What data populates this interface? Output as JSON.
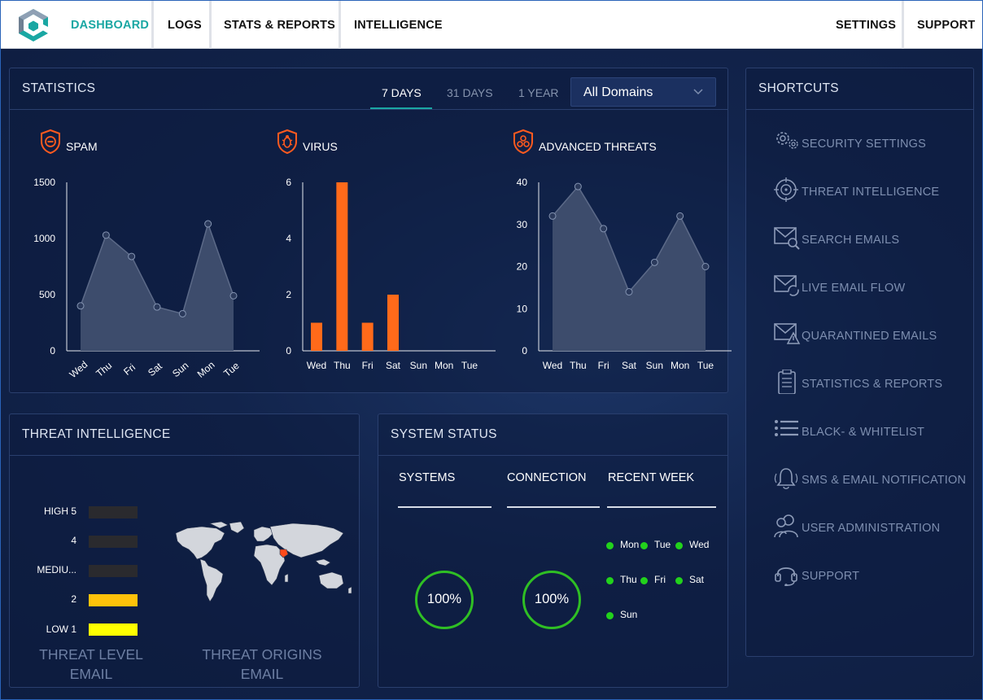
{
  "nav": {
    "items": [
      "DASHBOARD",
      "LOGS",
      "STATS & REPORTS",
      "INTELLIGENCE"
    ],
    "right_items": [
      "SETTINGS",
      "SUPPORT"
    ],
    "active": "DASHBOARD",
    "active_color": "#1aa7a3"
  },
  "statistics": {
    "title": "STATISTICS",
    "ranges": [
      "7 DAYS",
      "31 DAYS",
      "1 YEAR"
    ],
    "active_range": "7 DAYS",
    "domain_select": "All Domains"
  },
  "charts": {
    "spam": {
      "title": "SPAM",
      "icon": "shield-minus-icon"
    },
    "virus": {
      "title": "VIRUS",
      "icon": "shield-bug-icon"
    },
    "threats": {
      "title": "ADVANCED THREATS",
      "icon": "shield-biohazard-icon"
    }
  },
  "chart_data": [
    {
      "type": "area",
      "title": "SPAM",
      "categories": [
        "Wed",
        "Thu",
        "Fri",
        "Sat",
        "Sun",
        "Mon",
        "Tue"
      ],
      "values": [
        400,
        1030,
        840,
        390,
        330,
        1130,
        490
      ],
      "ylim": [
        0,
        1500
      ],
      "yticks": [
        0,
        500,
        1000,
        1500
      ],
      "color": "#3d4c6c"
    },
    {
      "type": "bar",
      "title": "VIRUS",
      "categories": [
        "Wed",
        "Thu",
        "Fri",
        "Sat",
        "Sun",
        "Mon",
        "Tue"
      ],
      "values": [
        1,
        6,
        1,
        2,
        0,
        0,
        0
      ],
      "ylim": [
        0,
        6
      ],
      "yticks": [
        0,
        2,
        4,
        6
      ],
      "color": "#ff6a1a"
    },
    {
      "type": "area",
      "title": "ADVANCED THREATS",
      "categories": [
        "Wed",
        "Thu",
        "Fri",
        "Sat",
        "Sun",
        "Mon",
        "Tue"
      ],
      "values": [
        32,
        39,
        29,
        14,
        21,
        32,
        20
      ],
      "ylim": [
        0,
        40
      ],
      "yticks": [
        0,
        10,
        20,
        30,
        40
      ],
      "color": "#3d4c6c"
    }
  ],
  "threat_intel": {
    "title": "THREAT INTELLIGENCE",
    "levels": [
      {
        "label": "HIGH 5",
        "color": "#2a2a2e"
      },
      {
        "label": "4",
        "color": "#2a2a2e"
      },
      {
        "label": "MEDIU...",
        "color": "#2a2a2e"
      },
      {
        "label": "2",
        "color": "#ffc20a"
      },
      {
        "label": "LOW 1",
        "color": "#ffff00"
      }
    ],
    "level_caption": [
      "THREAT LEVEL",
      "EMAIL"
    ],
    "origins_caption": [
      "THREAT ORIGINS",
      "EMAIL"
    ]
  },
  "system_status": {
    "title": "SYSTEM STATUS",
    "systems": {
      "label": "SYSTEMS",
      "value": "100%",
      "fraction": 1.0
    },
    "connection": {
      "label": "CONNECTION",
      "value": "100%",
      "fraction": 1.0
    },
    "recent_week": {
      "label": "RECENT WEEK",
      "days": [
        "Mon",
        "Tue",
        "Wed",
        "Thu",
        "Fri",
        "Sat",
        "Sun"
      ]
    },
    "ok_color": "#22d21c"
  },
  "shortcuts": {
    "title": "SHORTCUTS",
    "items": [
      {
        "label": "SECURITY SETTINGS",
        "icon": "gears-icon"
      },
      {
        "label": "THREAT INTELLIGENCE",
        "icon": "crosshair-icon"
      },
      {
        "label": "SEARCH EMAILS",
        "icon": "envelope-search-icon"
      },
      {
        "label": "LIVE EMAIL FLOW",
        "icon": "envelope-refresh-icon"
      },
      {
        "label": "QUARANTINED EMAILS",
        "icon": "envelope-warning-icon"
      },
      {
        "label": "STATISTICS & REPORTS",
        "icon": "clipboard-icon"
      },
      {
        "label": "BLACK- & WHITELIST",
        "icon": "list-icon"
      },
      {
        "label": "SMS & EMAIL NOTIFICATION",
        "icon": "bell-icon"
      },
      {
        "label": "USER ADMINISTRATION",
        "icon": "users-icon"
      },
      {
        "label": "SUPPORT",
        "icon": "headset-icon"
      }
    ]
  }
}
